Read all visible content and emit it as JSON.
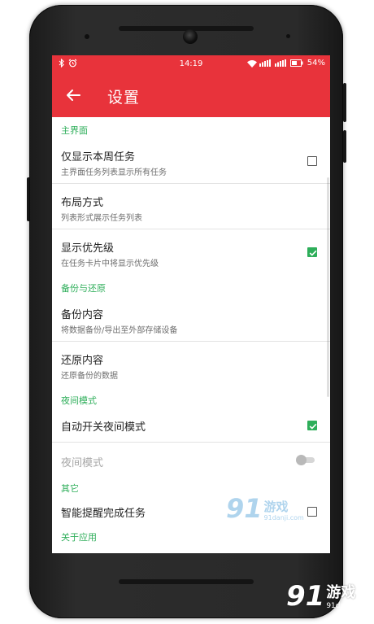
{
  "status_bar": {
    "time": "14:19",
    "battery": "54%"
  },
  "app_bar": {
    "title": "设置"
  },
  "sections": {
    "main": {
      "header": "主界面",
      "items": [
        {
          "title": "仅显示本周任务",
          "subtitle": "主界面任务列表显示所有任务",
          "control": "checkbox",
          "checked": false
        },
        {
          "title": "布局方式",
          "subtitle": "列表形式展示任务列表"
        },
        {
          "title": "显示优先级",
          "subtitle": "在任务卡片中将显示优先级",
          "control": "checkbox",
          "checked": true
        }
      ]
    },
    "backup": {
      "header": "备份与还原",
      "items": [
        {
          "title": "备份内容",
          "subtitle": "将数据备份/导出至外部存储设备"
        },
        {
          "title": "还原内容",
          "subtitle": "还原备份的数据"
        }
      ]
    },
    "night": {
      "header": "夜间模式",
      "items": [
        {
          "title": "自动开关夜间模式",
          "control": "checkbox",
          "checked": true
        },
        {
          "title": "夜间模式",
          "control": "toggle",
          "enabled": false,
          "on": false
        }
      ]
    },
    "other": {
      "header": "其它",
      "items": [
        {
          "title": "智能提醒完成任务",
          "control": "checkbox",
          "checked": false
        }
      ]
    },
    "about": {
      "header": "关于应用"
    }
  },
  "watermark": {
    "number": "91",
    "brand": "游戏",
    "url": "91danji.com"
  },
  "colors": {
    "primary": "#e8333b",
    "accent": "#2eae5a"
  },
  "icons": [
    "bluetooth-icon",
    "alarm-icon",
    "wifi-icon",
    "signal-icon",
    "battery-icon",
    "back-arrow-icon",
    "checkbox-icon",
    "toggle-switch"
  ]
}
